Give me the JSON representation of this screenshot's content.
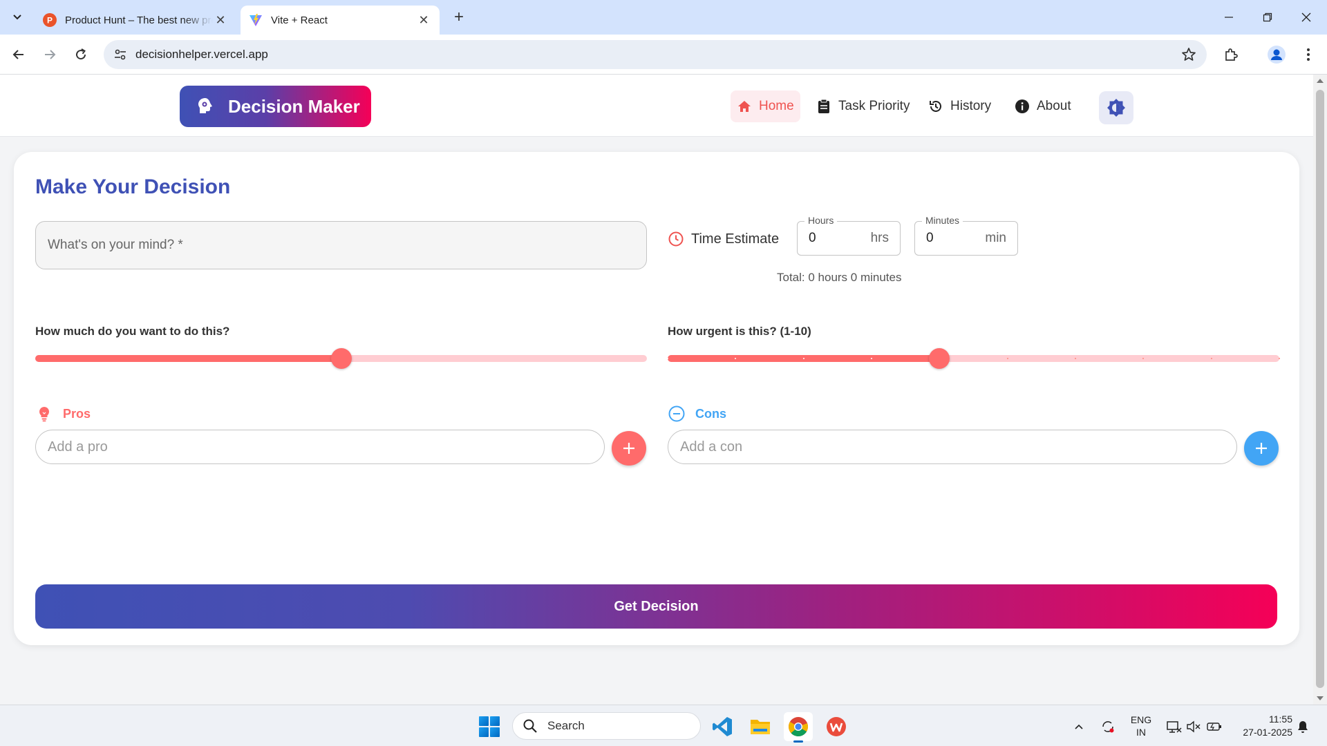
{
  "browser": {
    "tabs": [
      {
        "title": "Product Hunt – The best new products in tech.",
        "favicon": "product-hunt-icon",
        "active": false
      },
      {
        "title": "Vite + React",
        "favicon": "vite-icon",
        "active": true
      }
    ],
    "url": "decisionhelper.vercel.app"
  },
  "app": {
    "brand": "Decision Maker",
    "nav": [
      {
        "label": "Home",
        "icon": "home-icon",
        "active": true
      },
      {
        "label": "Task Priority",
        "icon": "clipboard-icon",
        "active": false
      },
      {
        "label": "History",
        "icon": "history-icon",
        "active": false
      },
      {
        "label": "About",
        "icon": "info-icon",
        "active": false
      }
    ],
    "colors": {
      "primary": "#3f51b5",
      "accent": "#f50057",
      "pros": "#ff6b6b",
      "cons": "#42a5f5"
    }
  },
  "form": {
    "title": "Make Your Decision",
    "mind_placeholder": "What's on your mind? *",
    "time_estimate_label": "Time Estimate",
    "hours": {
      "label": "Hours",
      "value": "0",
      "unit": "hrs"
    },
    "minutes": {
      "label": "Minutes",
      "value": "0",
      "unit": "min"
    },
    "total": "Total: 0 hours 0 minutes",
    "desire": {
      "label": "How much do you want to do this?",
      "value": 5,
      "min": 0,
      "max": 10
    },
    "urgency": {
      "label": "How urgent is this? (1-10)",
      "value": 5,
      "min": 1,
      "max": 10
    },
    "pros": {
      "label": "Pros",
      "placeholder": "Add a pro"
    },
    "cons": {
      "label": "Cons",
      "placeholder": "Add a con"
    },
    "submit": "Get Decision"
  },
  "taskbar": {
    "search": "Search",
    "lang_top": "ENG",
    "lang_bottom": "IN",
    "time": "11:55",
    "date": "27-01-2025"
  }
}
